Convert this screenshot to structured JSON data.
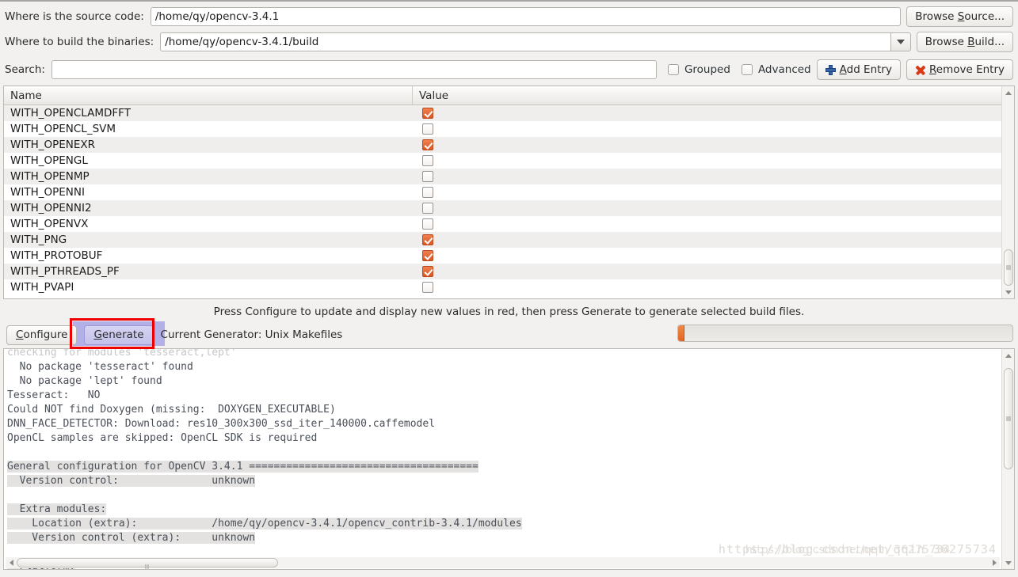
{
  "form": {
    "source_label": "Where is the source code:",
    "source_value": "/home/qy/opencv-3.4.1",
    "browse_source": "Browse Source...",
    "build_label": "Where to build the binaries:",
    "build_value": "/home/qy/opencv-3.4.1/build",
    "browse_build": "Browse Build..."
  },
  "search": {
    "label": "Search:",
    "value": "",
    "placeholder": "",
    "grouped": "Grouped",
    "grouped_checked": false,
    "advanced": "Advanced",
    "advanced_checked": false,
    "add_entry": "Add Entry",
    "remove_entry": "Remove Entry"
  },
  "cache": {
    "columns": [
      "Name",
      "Value"
    ],
    "rows": [
      {
        "name": "WITH_OPENCLAMDFFT",
        "checked": true
      },
      {
        "name": "WITH_OPENCL_SVM",
        "checked": false
      },
      {
        "name": "WITH_OPENEXR",
        "checked": true
      },
      {
        "name": "WITH_OPENGL",
        "checked": false
      },
      {
        "name": "WITH_OPENMP",
        "checked": false
      },
      {
        "name": "WITH_OPENNI",
        "checked": false
      },
      {
        "name": "WITH_OPENNI2",
        "checked": false
      },
      {
        "name": "WITH_OPENVX",
        "checked": false
      },
      {
        "name": "WITH_PNG",
        "checked": true
      },
      {
        "name": "WITH_PROTOBUF",
        "checked": true
      },
      {
        "name": "WITH_PTHREADS_PF",
        "checked": true
      },
      {
        "name": "WITH_PVAPI",
        "checked": false
      }
    ]
  },
  "actions": {
    "hint": "Press Configure to update and display new values in red, then press Generate to generate selected build files.",
    "configure": "Configure",
    "generate": "Generate",
    "generator_status": "Current Generator: Unix Makefiles",
    "progress_percent": 2
  },
  "console": {
    "lines": [
      {
        "text": "checking for modules 'tesseract,lept'",
        "clipped": true,
        "sel": false
      },
      {
        "text": "  No package 'tesseract' found",
        "sel": false
      },
      {
        "text": "  No package 'lept' found",
        "sel": false
      },
      {
        "text": "Tesseract:   NO",
        "sel": false
      },
      {
        "text": "Could NOT find Doxygen (missing:  DOXYGEN_EXECUTABLE)",
        "sel": false
      },
      {
        "text": "DNN_FACE_DETECTOR: Download: res10_300x300_ssd_iter_140000.caffemodel",
        "sel": false
      },
      {
        "text": "OpenCL samples are skipped: OpenCL SDK is required",
        "sel": false
      },
      {
        "text": "",
        "sel": false
      },
      {
        "text": "General configuration for OpenCV 3.4.1 =====================================",
        "sel": true
      },
      {
        "text": "  Version control:               unknown",
        "sel": true
      },
      {
        "text": "",
        "sel": true
      },
      {
        "text": "  Extra modules:",
        "sel": true
      },
      {
        "text": "    Location (extra):            /home/qy/opencv-3.4.1/opencv_contrib-3.4.1/modules",
        "sel": true
      },
      {
        "text": "    Version control (extra):     unknown",
        "sel": true
      },
      {
        "text": "",
        "sel": true
      },
      {
        "text": "  Platform:",
        "sel": true
      }
    ],
    "watermark_mono": "https://blog.csdn.net/qqin_36275734",
    "watermark_sans": "https://blog.csdn.net/qqin_36275734"
  },
  "icons": {
    "add": "plus-icon",
    "remove": "cross-icon",
    "dropdown": "chevron-down-icon"
  }
}
